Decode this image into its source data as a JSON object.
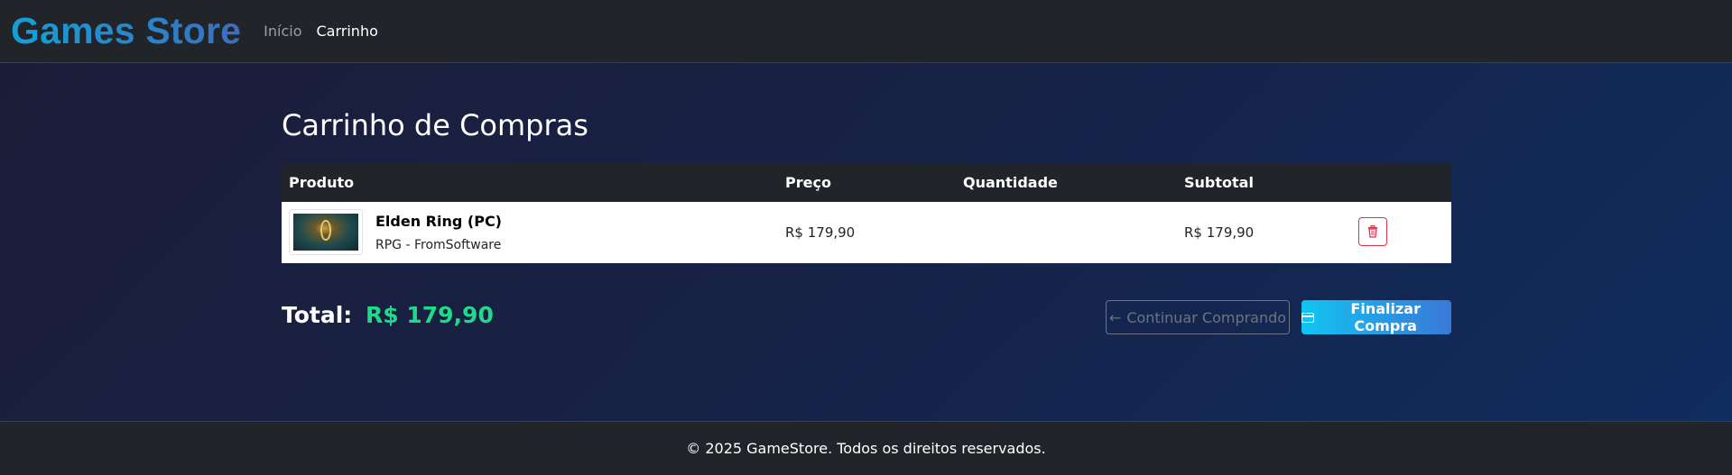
{
  "nav": {
    "brand": "Games Store",
    "links": [
      {
        "label": "Início",
        "active": false
      },
      {
        "label": "Carrinho",
        "active": true
      }
    ]
  },
  "cart": {
    "title": "Carrinho de Compras",
    "columns": [
      "Produto",
      "Preço",
      "Quantidade",
      "Subtotal"
    ],
    "items": [
      {
        "name": "Elden Ring (PC)",
        "subtitle": "RPG - FromSoftware",
        "price": "R$ 179,90",
        "quantity": "",
        "subtotal": "R$ 179,90",
        "image_icon": "game-cover-thumbnail"
      }
    ],
    "total_label": "Total:",
    "total_value": "R$ 179,90",
    "continue_label": "Continuar Comprando",
    "continue_icon": "arrow-left-icon",
    "finish_label": "Finalizar Compra",
    "finish_icon": "credit-card-icon",
    "remove_icon": "trash-icon"
  },
  "footer": {
    "text": "© 2025 GameStore. Todos os direitos reservados."
  },
  "colors": {
    "brand": "#1e8fc4",
    "total_amount": "#20d98a",
    "danger": "#dc3545",
    "primary_gradient_start": "#11c4f0",
    "primary_gradient_end": "#3a78d8"
  }
}
